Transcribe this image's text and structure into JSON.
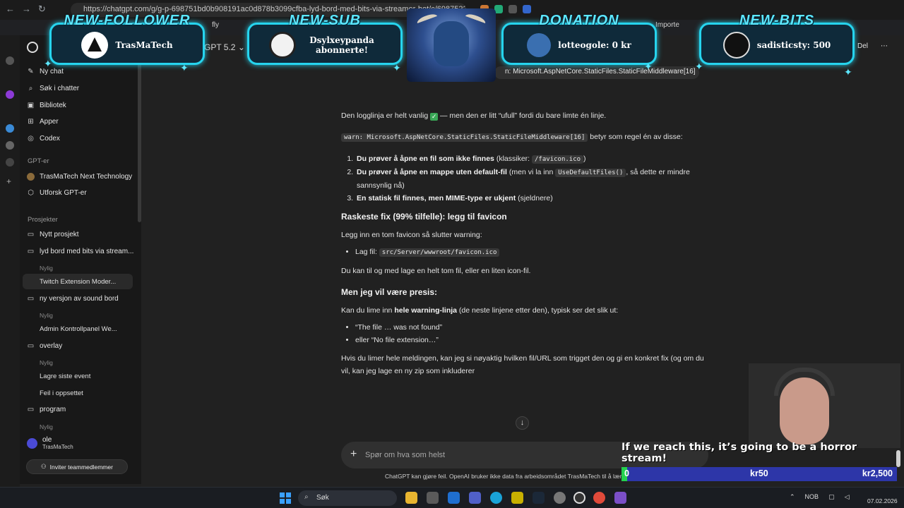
{
  "browser": {
    "url": "https://chatgpt.com/g/g-p-698751bd0b908191ac0d878b3099cfba-lyd-bord-med-bits-via-streamer-bot/c/6987522c-418c-8332",
    "bookmarks": [
      "fly",
      "Importe"
    ]
  },
  "header": {
    "model": "GPT 5.2",
    "delete_label": "Del",
    "more_label": "⋯",
    "warn_chip": "n: Microsoft.AspNetCore.StaticFiles.StaticFileMiddleware[16]"
  },
  "sidebar": {
    "top_items": [
      {
        "icon": "new-chat-icon",
        "label": "Ny chat"
      },
      {
        "icon": "search-icon",
        "label": "Søk i chatter"
      },
      {
        "icon": "library-icon",
        "label": "Bibliotek"
      },
      {
        "icon": "apps-icon",
        "label": "Apper"
      },
      {
        "icon": "codex-icon",
        "label": "Codex"
      }
    ],
    "gpts_heading": "GPT-er",
    "gpts": [
      {
        "icon": "gpt-avatar-icon",
        "label": "TrasMaTech Next Technology"
      },
      {
        "icon": "explore-gpts-icon",
        "label": "Utforsk GPT-er"
      }
    ],
    "projects_heading": "Prosjekter",
    "new_project": "Nytt prosjekt",
    "projects": [
      {
        "label": "lyd bord med bits via stream...",
        "recent": "Nylig",
        "chat": "Twitch Extension Moder..."
      },
      {
        "label": "ny versjon av sound bord",
        "recent": "Nylig",
        "chat": "Admin Kontrollpanel We..."
      },
      {
        "label": "overlay",
        "recent": "Nylig",
        "chats": [
          "Lagre siste event",
          "Feil i oppsettet"
        ]
      },
      {
        "label": "program",
        "recent": "Nylig"
      }
    ],
    "user": {
      "name": "ole",
      "workspace": "TrasMaTech"
    },
    "invite_label": "Inviter teammedlemmer"
  },
  "chat": {
    "p1_before": "Den logglinja er helt vanlig",
    "p1_after": "— men den er litt “ufull” fordi du bare limte én linje.",
    "p2_code": "warn: Microsoft.AspNetCore.StaticFiles.StaticFileMiddleware[16]",
    "p2_after": "betyr som regel én av disse:",
    "list": [
      {
        "bold": "Du prøver å åpne en fil som ikke finnes",
        "before": "(klassiker:",
        "code": "/favicon.ico",
        "after": ")"
      },
      {
        "bold": "Du prøver å åpne en mappe uten default-fil",
        "before": "(men vi la inn",
        "code": "UseDefaultFiles()",
        "after": ", så dette er mindre sannsynlig nå)"
      },
      {
        "bold": "En statisk fil finnes, men MIME-type er ukjent",
        "before": "(sjeldnere)",
        "code": "",
        "after": ""
      }
    ],
    "h1": "Raskeste fix (99% tilfelle): legg til favicon",
    "p3": "Legg inn en tom favicon så slutter warning:",
    "bullet1_label": "Lag fil:",
    "bullet1_code": "src/Server/wwwroot/favicon.ico",
    "p4": "Du kan til og med lage en helt tom fil, eller en liten icon-fil.",
    "h2": "Men jeg vil være presis:",
    "p5_before": "Kan du lime inn",
    "p5_bold": "hele warning-linja",
    "p5_after": "(de neste linjene etter den), typisk ser det slik ut:",
    "bullets2": [
      "“The file … was not found”",
      "eller “No file extension…”"
    ],
    "p6": "Hvis du limer hele meldingen, kan jeg si nøyaktig hvilken fil/URL som trigget den og gi en konkret fix (og om du vil, kan jeg lage en ny zip som inkluderer"
  },
  "composer": {
    "placeholder": "Spør om hva som helst",
    "disclaimer": "ChatGPT kan gjøre feil. OpenAI bruker ikke data fra arbeidsområdet TrasMaTech til å lære opp o"
  },
  "overlay": {
    "alerts": [
      {
        "title": "NEW-FOLLOWER",
        "text": "TrasMaTech"
      },
      {
        "title": "NEW-SUB",
        "text": "Dsylxeypanda abonnerte!"
      },
      {
        "title": "DONATION",
        "text": "lotteogole: 0 kr"
      },
      {
        "title": "NEW-BITS",
        "text": "sadisticsty: 500"
      }
    ],
    "goal": {
      "text": "If we reach this, it’s going to be a horror stream!",
      "start": "0",
      "current": "kr50",
      "target": "kr2,500",
      "progress": 0.02
    }
  },
  "taskbar": {
    "search": "Søk",
    "lang": "NOB",
    "date": "07.02.2026"
  },
  "colors": {
    "overlay_accent": "#26d4ee",
    "goal_fill": "#24d14f",
    "goal_bg": "#2d36a8"
  }
}
